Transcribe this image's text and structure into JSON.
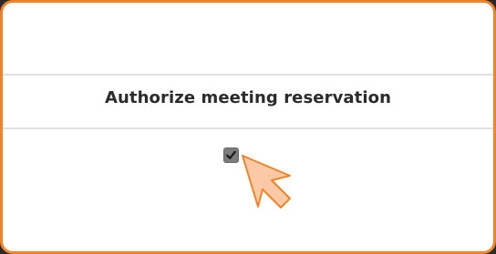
{
  "dialog": {
    "title": "Authorize meeting reservation",
    "checkbox_checked": true
  },
  "colors": {
    "border": "#f0832a",
    "checkbox_fill": "#7d7d7d",
    "cursor_fill": "#fbc9a6",
    "cursor_stroke": "#f0832a",
    "title_text": "#2b2b2b"
  },
  "icons": {
    "checkmark": "checkmark-icon",
    "cursor": "pointer-cursor-icon"
  }
}
